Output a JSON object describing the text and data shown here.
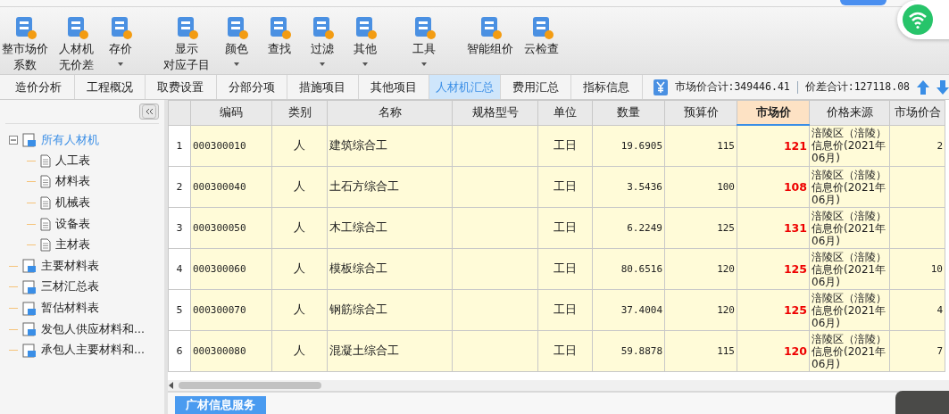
{
  "toolbar": {
    "groups": [
      [
        {
          "label": "整市场价",
          "label2": "系数",
          "dropdown": false
        },
        {
          "label": "人材机",
          "label2": "无价差",
          "dropdown": false
        },
        {
          "label": "存价",
          "dropdown": true
        }
      ],
      [
        {
          "label": "显示",
          "label2": "对应子目",
          "dropdown": false
        },
        {
          "label": "颜色",
          "dropdown": true
        },
        {
          "label": "查找",
          "dropdown": false
        },
        {
          "label": "过滤",
          "dropdown": true
        },
        {
          "label": "其他",
          "dropdown": true
        }
      ],
      [
        {
          "label": "工具",
          "dropdown": true
        }
      ],
      [
        {
          "label": "智能组价",
          "dropdown": false
        },
        {
          "label": "云检查",
          "dropdown": false
        }
      ]
    ]
  },
  "tabs": [
    {
      "label": "造价分析",
      "selected": false
    },
    {
      "label": "工程概况",
      "selected": false
    },
    {
      "label": "取费设置",
      "selected": false
    },
    {
      "label": "分部分项",
      "selected": false
    },
    {
      "label": "措施项目",
      "selected": false
    },
    {
      "label": "其他项目",
      "selected": false
    },
    {
      "label": "人材机汇总",
      "selected": true
    },
    {
      "label": "费用汇总",
      "selected": false
    },
    {
      "label": "指标信息",
      "selected": false
    }
  ],
  "summary": {
    "market_total": "市场价合计:349446.41",
    "diff_total": "价差合计:127118.08"
  },
  "tree": [
    {
      "label": "所有人材机",
      "expanded": true,
      "selected": true,
      "children": [
        {
          "label": "人工表"
        },
        {
          "label": "材料表"
        },
        {
          "label": "机械表"
        },
        {
          "label": "设备表"
        },
        {
          "label": "主材表"
        }
      ]
    },
    {
      "label": "主要材料表",
      "selected": false
    },
    {
      "label": "三材汇总表",
      "selected": false
    },
    {
      "label": "暂估材料表",
      "selected": false
    },
    {
      "label": "发包人供应材料和...",
      "selected": false
    },
    {
      "label": "承包人主要材料和...",
      "selected": false
    }
  ],
  "table": {
    "columns": [
      {
        "label": "编码",
        "selected": false
      },
      {
        "label": "类别",
        "selected": false
      },
      {
        "label": "名称",
        "selected": false
      },
      {
        "label": "规格型号",
        "selected": false
      },
      {
        "label": "单位",
        "selected": false
      },
      {
        "label": "数量",
        "selected": false
      },
      {
        "label": "预算价",
        "selected": false
      },
      {
        "label": "市场价",
        "selected": true
      },
      {
        "label": "价格来源",
        "selected": false
      },
      {
        "label": "市场价合",
        "selected": false
      }
    ],
    "rows": [
      {
        "no": "1",
        "code": "000300010",
        "type": "人",
        "name": "建筑综合工",
        "unit": "工日",
        "qty": "19.6905",
        "budget": "115",
        "market": "121",
        "source": "涪陵区（涪陵）信息价(2021年06月)",
        "column_11": "2"
      },
      {
        "no": "2",
        "code": "000300040",
        "type": "人",
        "name": "土石方综合工",
        "unit": "工日",
        "qty": "3.5436",
        "budget": "100",
        "market": "108",
        "source": "涪陵区（涪陵）信息价(2021年06月)"
      },
      {
        "no": "3",
        "code": "000300050",
        "type": "人",
        "name": "木工综合工",
        "unit": "工日",
        "qty": "6.2249",
        "budget": "125",
        "market": "131",
        "source": "涪陵区（涪陵）信息价(2021年06月)"
      },
      {
        "no": "4",
        "code": "000300060",
        "type": "人",
        "name": "模板综合工",
        "unit": "工日",
        "qty": "80.6516",
        "budget": "120",
        "market": "125",
        "source": "涪陵区（涪陵）信息价(2021年06月)",
        "column_11": "10"
      },
      {
        "no": "5",
        "code": "000300070",
        "type": "人",
        "name": "钢筋综合工",
        "unit": "工日",
        "qty": "37.4004",
        "budget": "120",
        "market": "125",
        "source": "涪陵区（涪陵）信息价(2021年06月)",
        "column_11": "4"
      },
      {
        "no": "6",
        "code": "000300080",
        "type": "人",
        "name": "混凝土综合工",
        "unit": "工日",
        "qty": "59.8878",
        "budget": "115",
        "market": "120",
        "source": "涪陵区（涪陵）信息价(2021年06月)",
        "column_11": "7"
      }
    ]
  },
  "bottom_button": "广材信息服务"
}
